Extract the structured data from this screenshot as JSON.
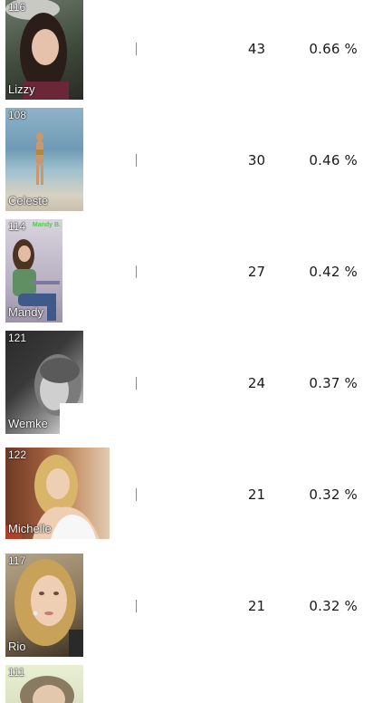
{
  "entries": [
    {
      "rank": "116",
      "name": "Lizzy",
      "votes": "43",
      "percent": "0.66 %"
    },
    {
      "rank": "108",
      "name": "Celeste",
      "votes": "30",
      "percent": "0.46 %",
      "watermark": ""
    },
    {
      "rank": "114",
      "name": "Mandy",
      "votes": "27",
      "percent": "0.42 %",
      "watermark": "Mandy B."
    },
    {
      "rank": "121",
      "name": "Wemke",
      "votes": "24",
      "percent": "0.37 %"
    },
    {
      "rank": "122",
      "name": "Michelle",
      "votes": "21",
      "percent": "0.32 %"
    },
    {
      "rank": "117",
      "name": "Rio",
      "votes": "21",
      "percent": "0.32 %"
    },
    {
      "rank": "111",
      "name": "",
      "votes": "",
      "percent": ""
    }
  ],
  "colors": {
    "text": "#1a1a1a",
    "bar": "#8a8a8a",
    "label_text": "#ffffff"
  }
}
